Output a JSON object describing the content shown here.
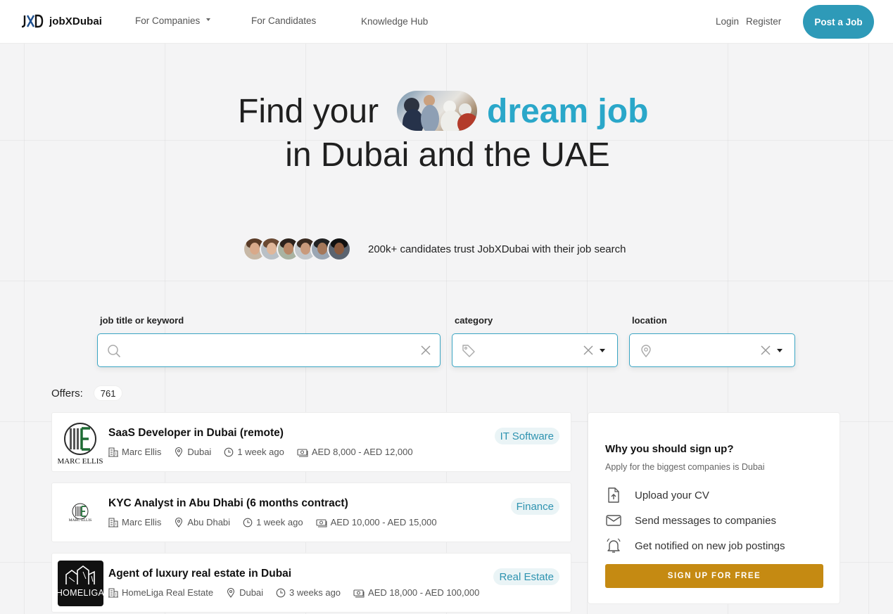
{
  "header": {
    "logo_text": "jobXDubai",
    "nav": {
      "for_companies": "For Companies",
      "for_candidates": "For Candidates",
      "knowledge_hub": "Knowledge Hub"
    },
    "login": "Login",
    "register": "Register",
    "post_job": "Post a Job"
  },
  "hero": {
    "title_start": "Find your",
    "title_highlight": "dream job",
    "title_line2": "in Dubai and the UAE",
    "trust_text": "200k+ candidates trust JobXDubai with their job search"
  },
  "search": {
    "keyword_label": "job title or keyword",
    "keyword_value": "",
    "category_label": "category",
    "category_value": "",
    "location_label": "location",
    "location_value": ""
  },
  "offers": {
    "label": "Offers:",
    "count": "761"
  },
  "jobs": [
    {
      "title": "SaaS Developer in Dubai (remote)",
      "company": "Marc Ellis",
      "location": "Dubai",
      "posted": "1 week ago",
      "salary": "AED 8,000 - AED 12,000",
      "category": "IT Software",
      "logo_text": "MARC ELLIS"
    },
    {
      "title": "KYC Analyst in Abu Dhabi (6 months contract)",
      "company": "Marc Ellis",
      "location": "Abu Dhabi",
      "posted": "1 week ago",
      "salary": "AED 10,000 - AED 15,000",
      "category": "Finance",
      "logo_text": "MARC ELLIS"
    },
    {
      "title": "Agent of luxury real estate in Dubai",
      "company": "HomeLiga Real Estate",
      "location": "Dubai",
      "posted": "3 weeks ago",
      "salary": "AED 18,000 - AED 100,000",
      "category": "Real Estate",
      "logo_text": "HOMELIGA"
    }
  ],
  "sidebar": {
    "title": "Why you should sign up?",
    "subtitle": "Apply for the biggest companies is Dubai",
    "benefits": [
      {
        "icon": "upload-file-icon",
        "text": "Upload your CV"
      },
      {
        "icon": "envelope-icon",
        "text": "Send messages to companies"
      },
      {
        "icon": "bell-icon",
        "text": "Get notified on new job postings"
      }
    ],
    "cta": "SIGN UP FOR FREE"
  },
  "colors": {
    "accent": "#2aa7c9",
    "button": "#2e9ab8",
    "cta": "#c58a12",
    "tag_bg": "#eaf4f6"
  }
}
